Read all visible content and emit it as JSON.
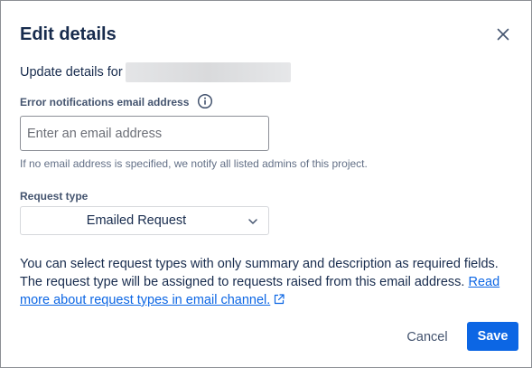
{
  "dialog": {
    "title": "Edit details",
    "close_icon": "close-icon"
  },
  "update": {
    "prefix": "Update details for"
  },
  "email_field": {
    "label": "Error notifications email address",
    "info_icon": "info-icon",
    "value": "",
    "placeholder": "Enter an email address",
    "helper": "If no email address is specified, we notify all listed admins of this project."
  },
  "request_type": {
    "label": "Request type",
    "selected": "Emailed Request",
    "chevron_icon": "chevron-down-icon"
  },
  "description": {
    "text": "You can select request types with only summary and description as required fields. The request type will be assigned to requests raised from this email address. ",
    "link_text": "Read more about request types in email channel.",
    "link_icon": "external-link-icon"
  },
  "footer": {
    "cancel_label": "Cancel",
    "save_label": "Save"
  },
  "colors": {
    "primary": "#0c66e4",
    "text": "#172b4d",
    "subtle_text": "#626f86",
    "link": "#0c66e4"
  }
}
